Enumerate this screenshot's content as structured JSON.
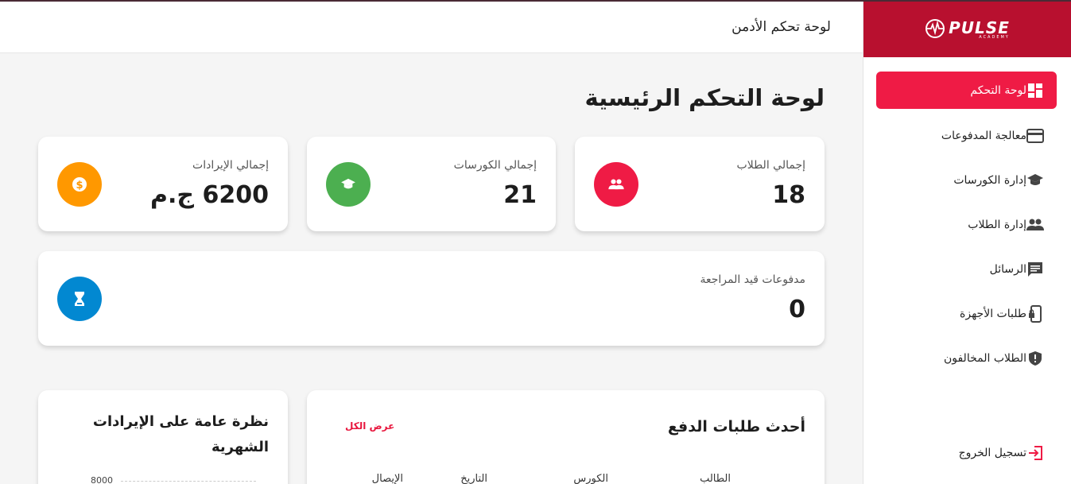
{
  "brand": {
    "logo_text": "PULSE",
    "logo_sub": "ACADEMY"
  },
  "header": {
    "title": "لوحة تحكم الأدمن"
  },
  "sidebar": {
    "items": [
      {
        "label": "لوحة التحكم",
        "icon": "dashboard-icon",
        "active": true
      },
      {
        "label": "معالجة المدفوعات",
        "icon": "credit-card-icon"
      },
      {
        "label": "إدارة الكورسات",
        "icon": "graduation-cap-icon"
      },
      {
        "label": "إدارة الطلاب",
        "icon": "people-icon"
      },
      {
        "label": "الرسائل",
        "icon": "message-icon"
      },
      {
        "label": "طلبات الأجهزة",
        "icon": "device-lock-icon"
      },
      {
        "label": "الطلاب المخالفون",
        "icon": "shield-alert-icon"
      }
    ],
    "logout": {
      "label": "تسجيل الخروج",
      "icon": "logout-icon"
    }
  },
  "main": {
    "page_title": "لوحة التحكم الرئيسية",
    "stats": {
      "students": {
        "label": "إجمالي الطلاب",
        "value": "18",
        "icon": "people-icon",
        "color": "#ef1b45"
      },
      "courses": {
        "label": "إجمالي الكورسات",
        "value": "21",
        "icon": "graduation-cap-icon",
        "color": "#4caf50"
      },
      "revenue": {
        "label": "إجمالي الإيرادات",
        "value": "6200 ج.م",
        "icon": "dollar-icon",
        "color": "#ff9800"
      },
      "pending": {
        "label": "مدفوعات قيد المراجعة",
        "value": "0",
        "icon": "hourglass-icon",
        "color": "#0288d1"
      }
    },
    "payments": {
      "title": "أحدث طلبات الدفع",
      "view_all": "عرض الكل",
      "columns": [
        "الطالب",
        "الكورس",
        "التاريخ",
        "الإيصال"
      ]
    },
    "revenue_chart": {
      "title": "نظرة عامة على الإيرادات الشهرية",
      "ytick_top": "8000"
    }
  },
  "colors": {
    "accent": "#ef1b45",
    "brand_bg": "#b8102f"
  }
}
